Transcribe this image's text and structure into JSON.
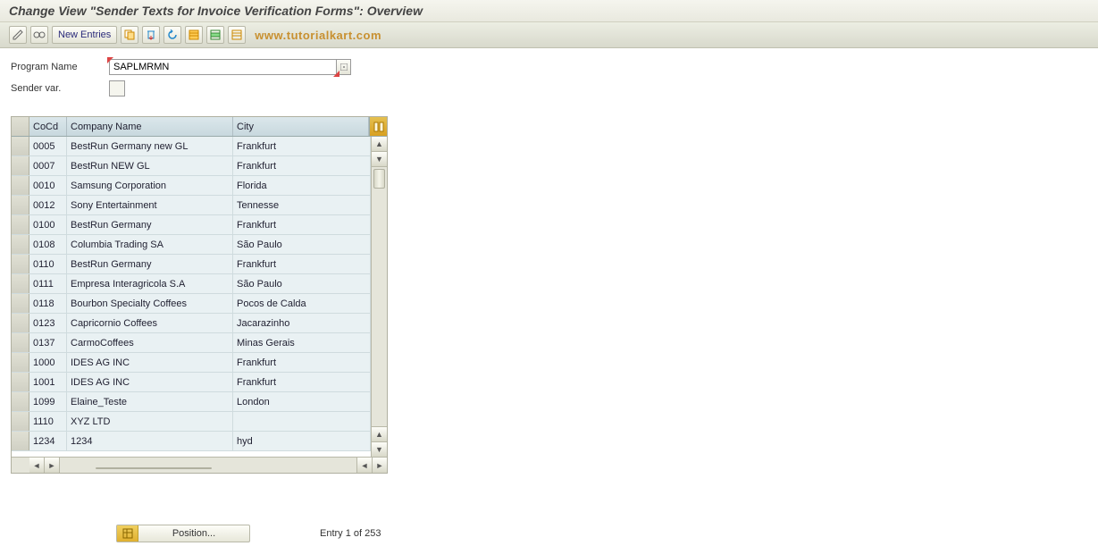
{
  "title": "Change View \"Sender Texts for Invoice Verification Forms\": Overview",
  "toolbar": {
    "new_entries_label": "New Entries"
  },
  "watermark": "www.tutorialkart.com",
  "form": {
    "program_label": "Program Name",
    "program_value": "SAPLMRMN",
    "sender_var_label": "Sender var."
  },
  "table": {
    "headers": {
      "cocd": "CoCd",
      "name": "Company Name",
      "city": "City"
    },
    "rows": [
      {
        "cocd": "0005",
        "name": "BestRun Germany new GL",
        "city": "Frankfurt"
      },
      {
        "cocd": "0007",
        "name": "BestRun NEW GL",
        "city": "Frankfurt"
      },
      {
        "cocd": "0010",
        "name": "Samsung Corporation",
        "city": "Florida"
      },
      {
        "cocd": "0012",
        "name": "Sony Entertainment",
        "city": "Tennesse"
      },
      {
        "cocd": "0100",
        "name": "BestRun Germany",
        "city": "Frankfurt"
      },
      {
        "cocd": "0108",
        "name": "Columbia Trading SA",
        "city": "São Paulo"
      },
      {
        "cocd": "0110",
        "name": "BestRun Germany",
        "city": "Frankfurt"
      },
      {
        "cocd": "0111",
        "name": "Empresa Interagricola S.A",
        "city": "São Paulo"
      },
      {
        "cocd": "0118",
        "name": "Bourbon Specialty Coffees",
        "city": "Pocos de Calda"
      },
      {
        "cocd": "0123",
        "name": "Capricornio Coffees",
        "city": "Jacarazinho"
      },
      {
        "cocd": "0137",
        "name": "CarmoCoffees",
        "city": "Minas Gerais"
      },
      {
        "cocd": "1000",
        "name": "IDES AG INC",
        "city": "Frankfurt"
      },
      {
        "cocd": "1001",
        "name": "IDES AG INC",
        "city": "Frankfurt"
      },
      {
        "cocd": "1099",
        "name": "Elaine_Teste",
        "city": "London"
      },
      {
        "cocd": "1110",
        "name": "XYZ LTD",
        "city": ""
      },
      {
        "cocd": "1234",
        "name": "1234",
        "city": "hyd"
      }
    ]
  },
  "footer": {
    "position_label": "Position...",
    "entry_label": "Entry 1 of 253"
  },
  "icons": {
    "toggle": "toggle-display-change-icon",
    "glasses": "where-used-icon",
    "copy": "copy-icon",
    "save": "save-icon",
    "undo": "undo-icon",
    "select_all": "select-all-icon",
    "select_block": "select-block-icon",
    "deselect": "deselect-icon"
  }
}
